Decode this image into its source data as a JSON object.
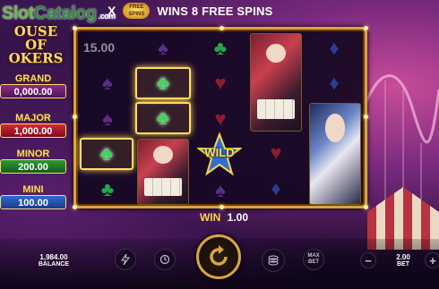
{
  "branding": {
    "watermark_part1": "Slot",
    "watermark_part2": "Catalog",
    "watermark_suffix": ".com",
    "logo_title_line1": "OUSE OF",
    "logo_title_line2": "OKERS"
  },
  "header": {
    "x_mark": "X",
    "free_spins_badge_top": "FREE",
    "free_spins_badge_bottom": "SPINS",
    "banner": "WINS 8 FREE SPINS"
  },
  "jackpots": [
    {
      "label": "GRAND",
      "value": "0,000.00"
    },
    {
      "label": "MAJOR",
      "value": "1,000.00"
    },
    {
      "label": "MINOR",
      "value": "200.00"
    },
    {
      "label": "MINI",
      "value": "100.00"
    }
  ],
  "reels": {
    "counter": "15.00",
    "wild_label": "WILD",
    "symbols": [
      {
        "icon": "spade-icon",
        "glyph": "♠",
        "suit": "spade"
      },
      {
        "icon": "club-icon",
        "glyph": "♣",
        "suit": "club"
      },
      {
        "icon": "diamond-icon",
        "glyph": "♦",
        "suit": "diamond"
      },
      {
        "icon": "heart-icon",
        "glyph": "♥",
        "suit": "heart"
      }
    ]
  },
  "win": {
    "label": "WIN",
    "value": "1.00"
  },
  "controls": {
    "balance_value": "1,984.00",
    "balance_label": "BALANCE",
    "bet_value": "2.00",
    "bet_label": "BET",
    "max_bet_line1": "MAX",
    "max_bet_line2": "BET",
    "minus": "−",
    "plus": "+"
  },
  "colors": {
    "frame_gold": "#d9a441",
    "win_label": "#ffd24a",
    "club_green": "#2aa34a"
  }
}
